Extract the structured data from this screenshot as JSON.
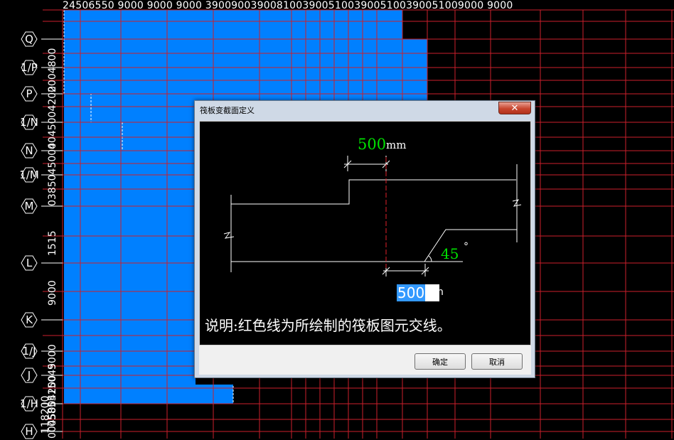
{
  "top_axis_text": "24506550     9000      9000      9000   3900900390081003900510039005100390051009000      9000",
  "left_axis_labels": [
    "Q",
    "1/P",
    "P",
    "1/N",
    "N",
    "1/M",
    "M",
    "L",
    "K",
    "1/J",
    "J",
    "1/H",
    "H"
  ],
  "left_dims": [
    "2004800",
    "0045004200",
    "0385045004",
    "1515",
    "9000",
    "9000",
    "0585515045",
    "118200",
    "0045004200"
  ],
  "colors": {
    "slab_fill": "#0080ff",
    "grid_line": "#cc1f2b",
    "background": "#000000",
    "dim_value": "#00e000"
  },
  "dialog": {
    "title": "筏板变截面定义",
    "close_icon": "✕",
    "top_value": "500",
    "top_unit": "mm",
    "angle_value": "45",
    "angle_unit": "°",
    "bottom_value": "500",
    "bottom_unit": "n",
    "note": "说明:红色线为所绘制的筏板图元交线。",
    "ok_label": "确定",
    "cancel_label": "取消"
  }
}
